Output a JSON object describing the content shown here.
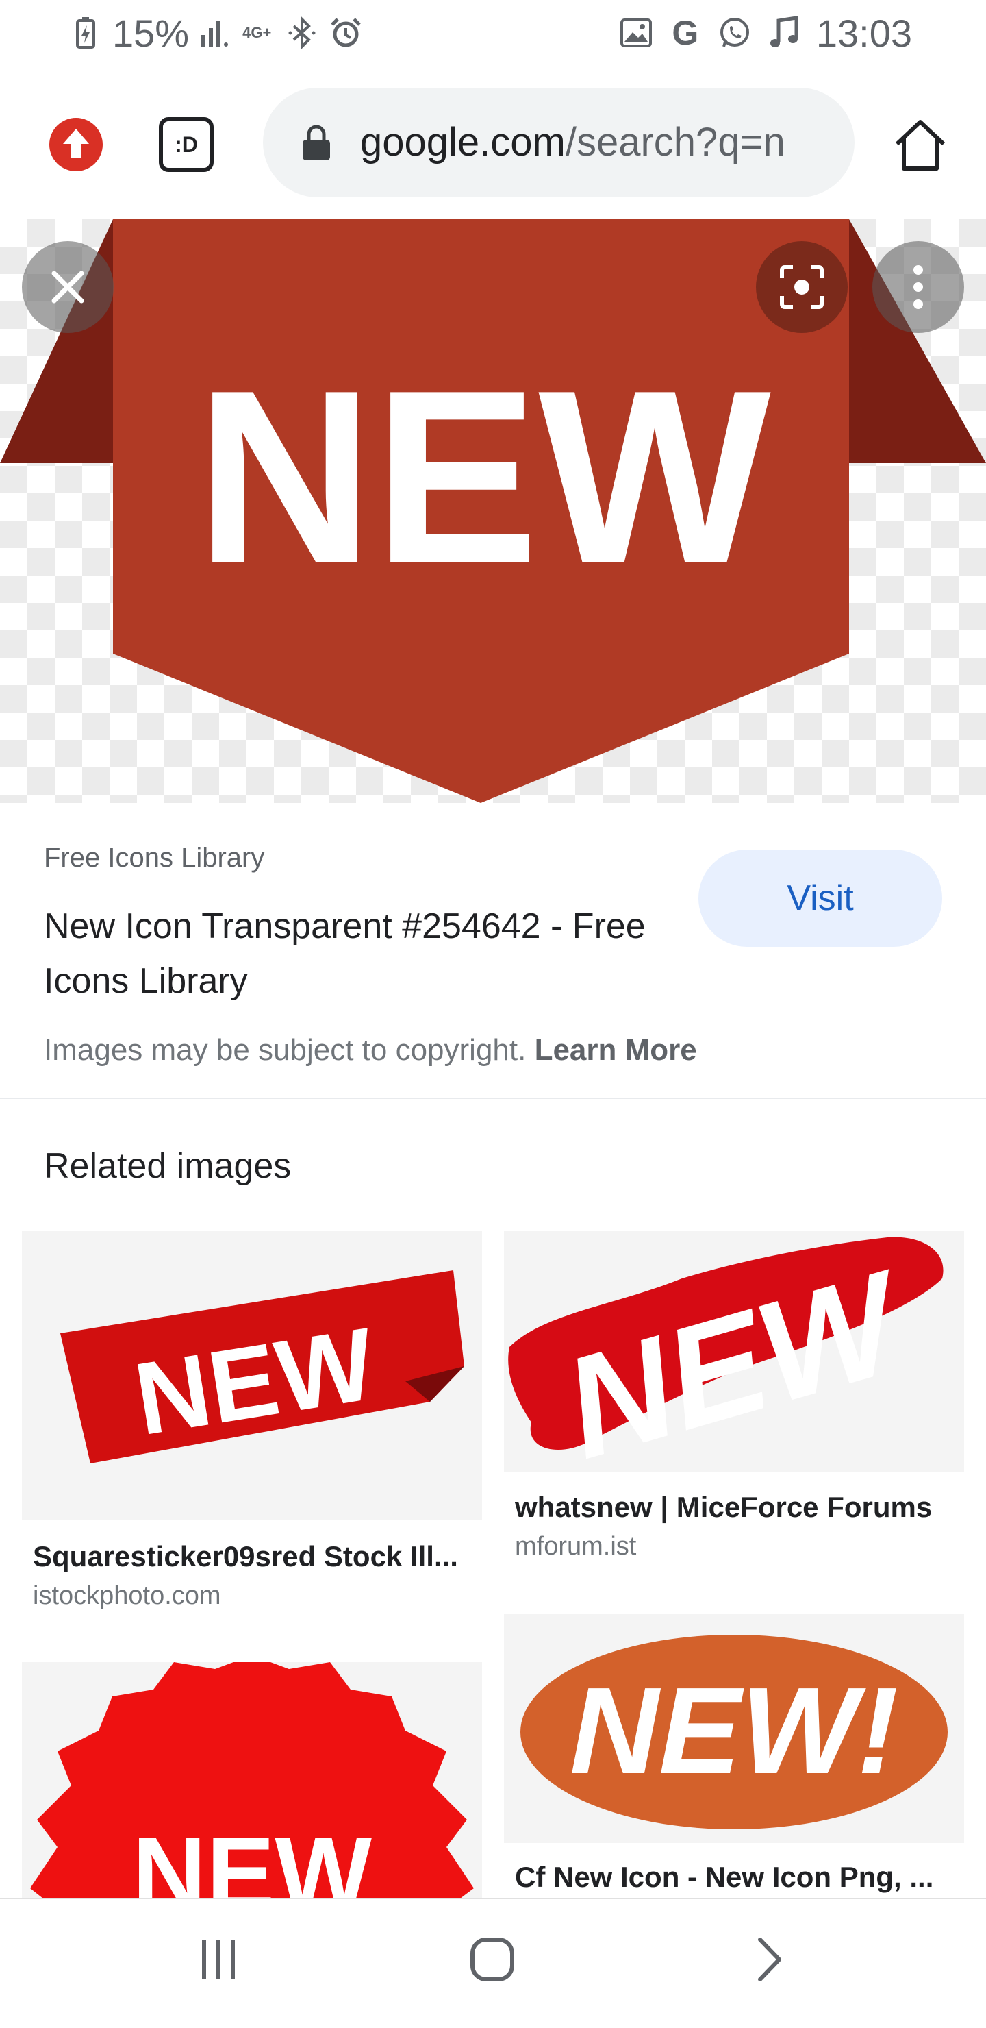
{
  "status_bar": {
    "battery": "15%",
    "network": "4G+",
    "time": "13:03"
  },
  "toolbar": {
    "tab_switcher_label": ":D",
    "url_domain": "google.com",
    "url_path": "/search?q=n"
  },
  "hero": {
    "badge_text": "NEW",
    "colors": {
      "banner": "#b03a25",
      "fold": "#7a1f14"
    }
  },
  "result": {
    "source": "Free Icons Library",
    "title": "New Icon Transparent #254642 - Free Icons Library",
    "visit_label": "Visit",
    "copyright_text": "Images may be subject to copyright.",
    "learn_more_label": "Learn More"
  },
  "related": {
    "heading": "Related images",
    "items": [
      {
        "title": "Squaresticker09sred Stock Ill...",
        "source": "istockphoto.com",
        "image_text": "NEW"
      },
      {
        "title": "whatsnew | MiceForce Forums",
        "source": "mforum.ist",
        "image_text": "NEW"
      },
      {
        "title": "",
        "source": "",
        "image_text": "NEW"
      },
      {
        "title": "Cf New Icon - New Icon Png, ...",
        "source": "",
        "image_text": "NEW!"
      }
    ]
  },
  "icons": {
    "status_left": [
      "battery-charging-icon",
      "signal-icon",
      "network-4g-icon",
      "bluetooth-icon",
      "alarm-icon"
    ],
    "status_right": [
      "gallery-icon",
      "google-icon",
      "whatsapp-icon",
      "music-icon"
    ],
    "toolbar": [
      "update-icon",
      "tab-switcher-icon",
      "lock-icon",
      "home-icon"
    ],
    "overlay": [
      "close-icon",
      "lens-icon",
      "more-vert-icon"
    ],
    "nav": [
      "recents-icon",
      "home-circle-icon",
      "back-icon"
    ]
  }
}
